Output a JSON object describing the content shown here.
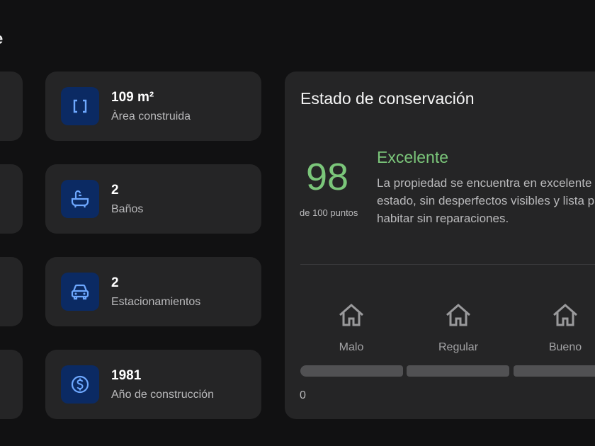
{
  "section": {
    "title": "e"
  },
  "features": [
    {
      "value": "109 m²",
      "label": "Àrea construida",
      "icon": "area-brackets-icon"
    },
    {
      "value": "2",
      "label": "Baños",
      "icon": "bathtub-icon"
    },
    {
      "value": "2",
      "label": "Estacionamientos",
      "icon": "car-icon"
    },
    {
      "value": "1981",
      "label": "Año de construcción",
      "icon": "dollar-coin-icon"
    }
  ],
  "condition": {
    "title": "Estado de conservación",
    "score": "98",
    "score_caption": "de 100 puntos",
    "rating": "Excelente",
    "description": "La propiedad se encuentra en excelente estado, sin desperfectos visibles y lista para habitar sin reparaciones.",
    "scale": [
      {
        "label": "Malo",
        "icon": "house-icon"
      },
      {
        "label": "Regular",
        "icon": "house-icon"
      },
      {
        "label": "Bueno",
        "icon": "house-icon"
      }
    ],
    "scale_min": "0"
  },
  "colors": {
    "background": "#111112",
    "card": "#252526",
    "icon_bg": "#0b2a63",
    "icon_fg": "#6ea8ff",
    "accent_green": "#7bc67a",
    "bar": "#515153"
  }
}
